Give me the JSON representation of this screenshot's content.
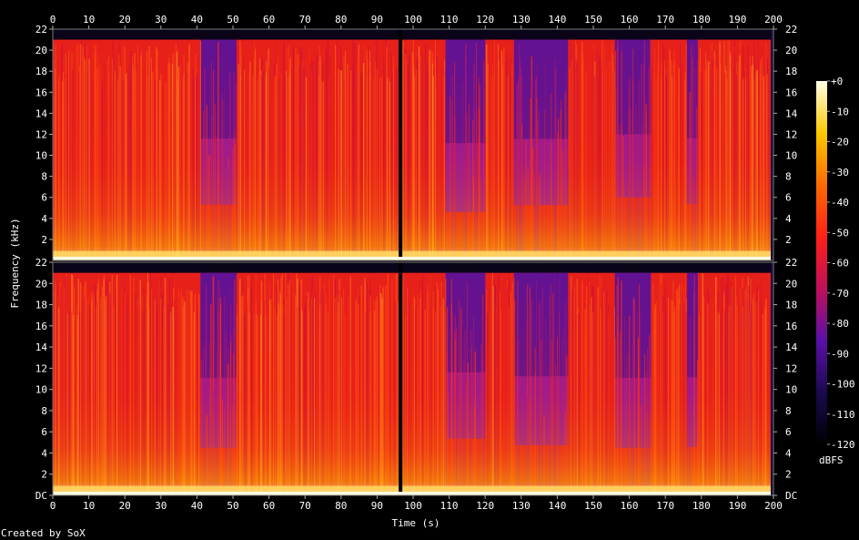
{
  "chart_data": {
    "type": "heatmap",
    "title": "",
    "xlabel": "Time (s)",
    "ylabel": "Frequency (kHz)",
    "xlim": [
      0,
      200
    ],
    "ylim": [
      0,
      22
    ],
    "x_ticks": [
      0,
      10,
      20,
      30,
      40,
      50,
      60,
      70,
      80,
      90,
      100,
      110,
      120,
      130,
      140,
      150,
      160,
      170,
      180,
      190,
      200
    ],
    "y_tick_values": [
      0,
      2,
      4,
      6,
      8,
      10,
      12,
      14,
      16,
      18,
      20,
      22
    ],
    "y_tick_labels": [
      "DC",
      "2",
      "4",
      "6",
      "8",
      "10",
      "12",
      "14",
      "16",
      "18",
      "20",
      "22"
    ],
    "channels": 2,
    "content_end_time": 200,
    "high_freq_cutoff_khz": 21,
    "silent_gap_time": 96.5,
    "quiet_segments": [
      {
        "start": 41,
        "end": 51
      },
      {
        "start": 109,
        "end": 120
      },
      {
        "start": 128,
        "end": 143
      },
      {
        "start": 156,
        "end": 166
      },
      {
        "start": 176,
        "end": 179
      }
    ],
    "colorbar": {
      "label": "dBFS",
      "ticks": [
        0,
        -10,
        -20,
        -30,
        -40,
        -50,
        -60,
        -70,
        -80,
        -90,
        -100,
        -110,
        -120
      ],
      "tick_labels": [
        "+0",
        "-10",
        "-20",
        "-30",
        "-40",
        "-50",
        "-60",
        "-70",
        "-80",
        "-90",
        "-100",
        "-110",
        "-120"
      ],
      "range": [
        -120,
        0
      ]
    },
    "footer": "Created by SoX",
    "colors": [
      "#000000",
      "#1a0a50",
      "#5a10a8",
      "#c0105a",
      "#ff2018",
      "#ff6a00",
      "#ffc800",
      "#ffffe8"
    ]
  }
}
